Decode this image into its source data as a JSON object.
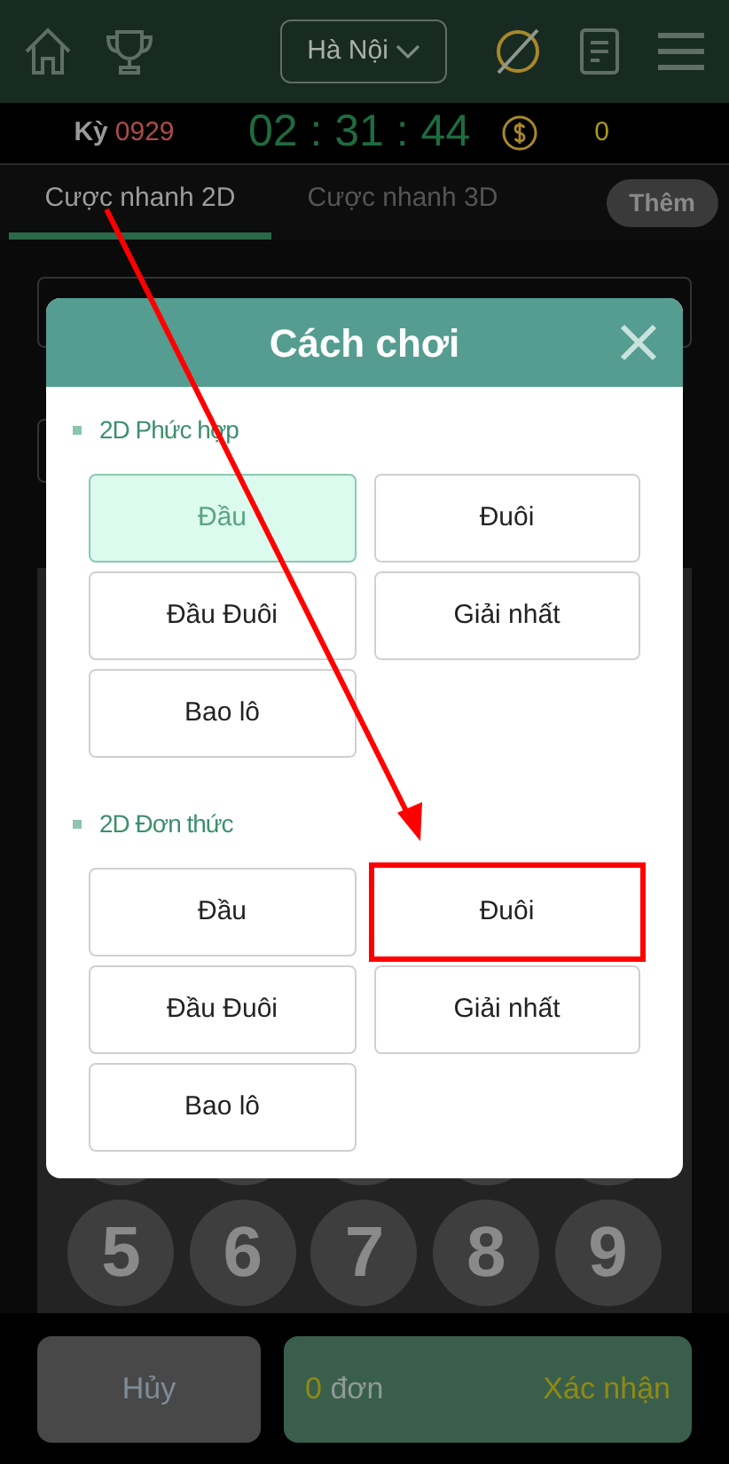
{
  "header": {
    "city_select": "Hà Nội"
  },
  "info": {
    "period_label": "Kỳ",
    "period": "0929",
    "timer": "02 : 31 : 44",
    "balance": "0"
  },
  "tabs": [
    {
      "label": "Cược nhanh 2D",
      "selected": true
    },
    {
      "label": "Cược nhanh 3D",
      "selected": false
    }
  ],
  "more_button": "Thêm",
  "keypad": {
    "keys": [
      "5",
      "6",
      "7",
      "8",
      "9"
    ]
  },
  "footer": {
    "cancel": "Hủy",
    "order_count": "0",
    "order_unit": "đơn",
    "confirm": "Xác nhận"
  },
  "modal": {
    "title": "Cách chơi",
    "sections": [
      {
        "title": "2D Phức hợp",
        "options": [
          {
            "label": "Đầu",
            "selected": true,
            "highlighted": false
          },
          {
            "label": "Đuôi",
            "selected": false,
            "highlighted": false
          },
          {
            "label": "Đầu Đuôi",
            "selected": false,
            "highlighted": false
          },
          {
            "label": "Giải nhất",
            "selected": false,
            "highlighted": false
          },
          {
            "label": "Bao lô",
            "selected": false,
            "highlighted": false
          }
        ]
      },
      {
        "title": "2D Đơn thức",
        "options": [
          {
            "label": "Đầu",
            "selected": false,
            "highlighted": false
          },
          {
            "label": "Đuôi",
            "selected": false,
            "highlighted": true
          },
          {
            "label": "Đầu Đuôi",
            "selected": false,
            "highlighted": false
          },
          {
            "label": "Giải nhất",
            "selected": false,
            "highlighted": false
          },
          {
            "label": "Bao lô",
            "selected": false,
            "highlighted": false
          }
        ]
      }
    ]
  }
}
